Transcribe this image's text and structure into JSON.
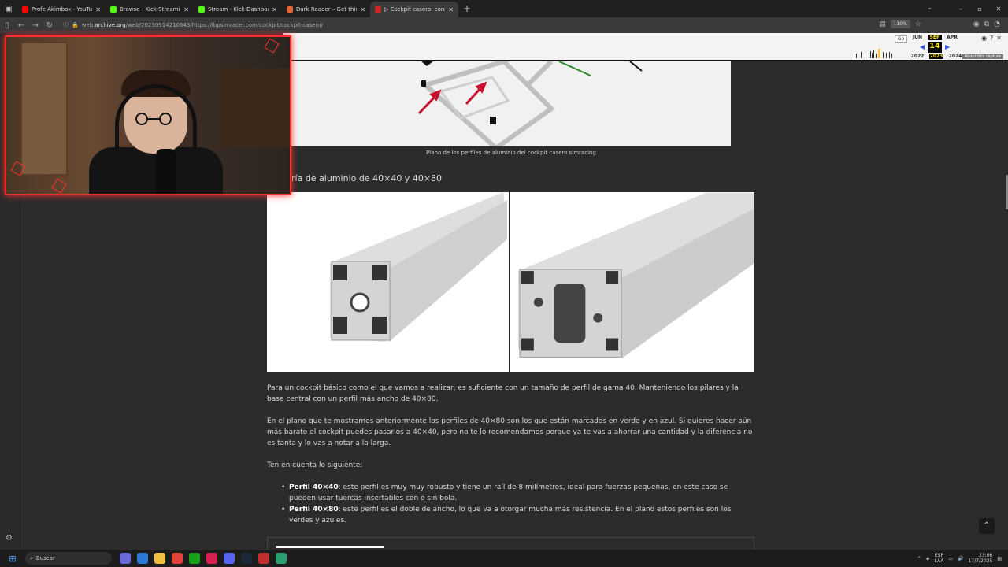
{
  "browser": {
    "tabs": [
      {
        "title": "Profe Akimbox - YouTube",
        "color": "#ff0000",
        "active": false
      },
      {
        "title": "Browse - Kick Streaming",
        "color": "#53fc18",
        "active": false
      },
      {
        "title": "Stream - Kick Dashboard",
        "color": "#53fc18",
        "active": false
      },
      {
        "title": "Dark Reader – Get this Extensio",
        "color": "#e0643c",
        "active": false
      },
      {
        "title": "▷ Cockpit casero: construye tu",
        "color": "#c62828",
        "active": true
      }
    ],
    "url_prefix": "web.",
    "url_host": "archive.org",
    "url_path": "/web/20230914210643/https://lbpsimracer.com/cockpit/cockpit-casero/",
    "zoom": "110%"
  },
  "wayback": {
    "go_label": "Go",
    "months": [
      "JUN",
      "SEP",
      "APR"
    ],
    "day": "14",
    "years": [
      "2022",
      "2023",
      "2024"
    ],
    "about_label": "About this capture"
  },
  "article": {
    "figure_caption": "Plano de los perfiles de aluminio del cockpit casero simracing",
    "section_heading": "ría de aluminio de 40×40 y 40×80",
    "paragraphs": [
      "Para un cockpit básico como el que vamos a realizar, es suficiente con un tamaño de perfil de gama 40. Manteniendo los pilares y la base central con un perfil más ancho de 40×80.",
      "En el plano que te mostramos anteriormente los perfiles de 40×80 son los que están marcados en verde y en azul. Si quieres hacer aún más barato el cockpit puedes pasarlos a 40×40, pero no te lo recomendamos porque ya te vas a ahorrar una cantidad y la diferencia no es tanta y lo vas a notar a la larga.",
      "Ten en cuenta lo siguiente:"
    ],
    "bullets": [
      {
        "bold": "Perfil 40×40",
        "text": ": este perfil es muy muy robusto y tiene un raíl de 8 milímetros, ideal para fuerzas pequeñas, en este caso se pueden usar tuercas insertables con o sin bola."
      },
      {
        "bold": "Perfil 40×80",
        "text": ": este perfil es el doble de ancho, lo que va a otorgar mucha más resistencia. En el plano estos perfiles son los verdes y azules."
      }
    ]
  },
  "taskbar": {
    "search_placeholder": "Buscar",
    "lang_top": "ESP",
    "lang_bottom": "LAA",
    "time": "23:06",
    "date": "17/7/2025"
  }
}
